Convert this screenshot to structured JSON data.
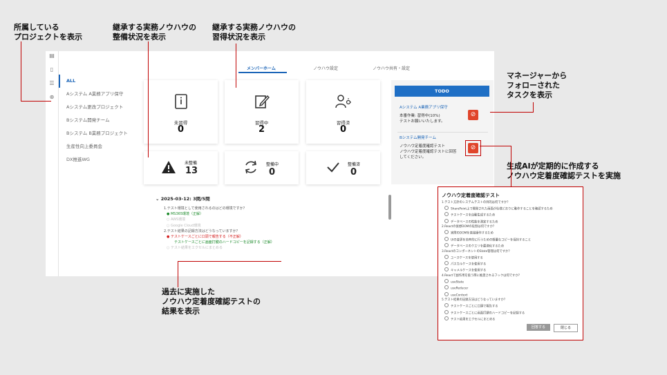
{
  "annotations": {
    "projects": "所属している\nプロジェクトを表示",
    "maintenance": "継承する実務ノウハウの\n整備状況を表示",
    "learning": "継承する実務ノウハウの\n習得状況を表示",
    "manager": "マネージャーから\nフォローされた\nタスクを表示",
    "ai_test": "生成AIが定期的に作成する\nノウハウ定着度確認テストを実施",
    "past_tests": "過去に実施した\nノウハウ定着度確認テストの\n結果を表示"
  },
  "tabs": [
    {
      "label": "メンバーホーム",
      "active": true
    },
    {
      "label": "ノウハウ設定",
      "active": false
    },
    {
      "label": "ノウハウ共有・設定",
      "active": false
    }
  ],
  "projects": [
    {
      "label": "ALL",
      "active": true
    },
    {
      "label": "Aシステム A業務アプリ保守"
    },
    {
      "label": "Aシステム更改プロジェクト"
    },
    {
      "label": "Bシステム開発チーム"
    },
    {
      "label": "Bシステム B業務プロジェクト"
    },
    {
      "label": "生産性向上委員会"
    },
    {
      "label": "DX推進WG"
    }
  ],
  "learning": [
    {
      "label": "未習得",
      "value": "0",
      "icon": "book-icon"
    },
    {
      "label": "習得中",
      "value": "2",
      "icon": "edit-icon"
    },
    {
      "label": "習得済",
      "value": "0",
      "icon": "person-idea-icon"
    }
  ],
  "maintenance": [
    {
      "label": "未整備",
      "value": "13",
      "icon": "warning-icon"
    },
    {
      "label": "整備中",
      "value": "0",
      "icon": "refresh-icon"
    },
    {
      "label": "整備済",
      "value": "0",
      "icon": "check-icon"
    }
  ],
  "history": {
    "title": "2025-03-12: 3問/5問",
    "lines": [
      "1.テスト環境として使用されるのはどの環境ですか？",
      "MS365環境（正解）",
      "AWS環境",
      "Google Cloud環境",
      "2.テスト結果の記録方法はどうなっていますか？",
      "テストケースごとに口頭で報告する（不正解）",
      "テストケースごとに画面打鍵のハードコピーを記録する（正解）",
      "テスト結果をエクセルにまとめる"
    ]
  },
  "todo": {
    "header": "TODO",
    "items": [
      {
        "project": "Aシステム A業務アプリ保守",
        "text1": "本番作業: 習得中(10%)",
        "text2": "テストお願いいたします。"
      },
      {
        "project": "Bシステム開発チーム",
        "text1": "ノウハウ定着度確認テスト",
        "text2": "ノウハウ定着度確認テストに回答",
        "text3": "してください。"
      }
    ]
  },
  "modal": {
    "title": "ノウハウ定着度確認テスト",
    "lines": [
      "1.テスト方針のシステムテストの目的は何ですか？",
      "SharePoint上で開発された画面が仕様どおりに動作することを確認するため",
      "テストケースを自動生成するため",
      "データベースの性能を測定するため",
      "2.Reactの仮想DOMの役割は何ですか？",
      "実際のDOMを直接操作するため",
      "UIの変更を効率的に行うための軽量なコピーを保持すること",
      "データベースのクエリを最適化するため",
      "3.ReactのコンポーネントのState管理は何ですか？",
      "ユースケースを使用する",
      "パスカルケースを使用する",
      "キャメルケースを使用する",
      "4.Reactで副作用を扱う際に推奨されるフックは何ですか？",
      "useState",
      "useReducer",
      "useContext",
      "5.テスト結果の記録方法はどうなっていますか？",
      "テストケースごとに口頭で報告する",
      "テストケースごとに画面打鍵のハードコピーを記録する",
      "テスト結果をエクセルにまとめる"
    ],
    "submit": "回答する",
    "close": "閉じる"
  },
  "colors": {
    "accent": "#1a64b7",
    "annotation": "#c00000",
    "todo_icon": "#e0452b"
  }
}
